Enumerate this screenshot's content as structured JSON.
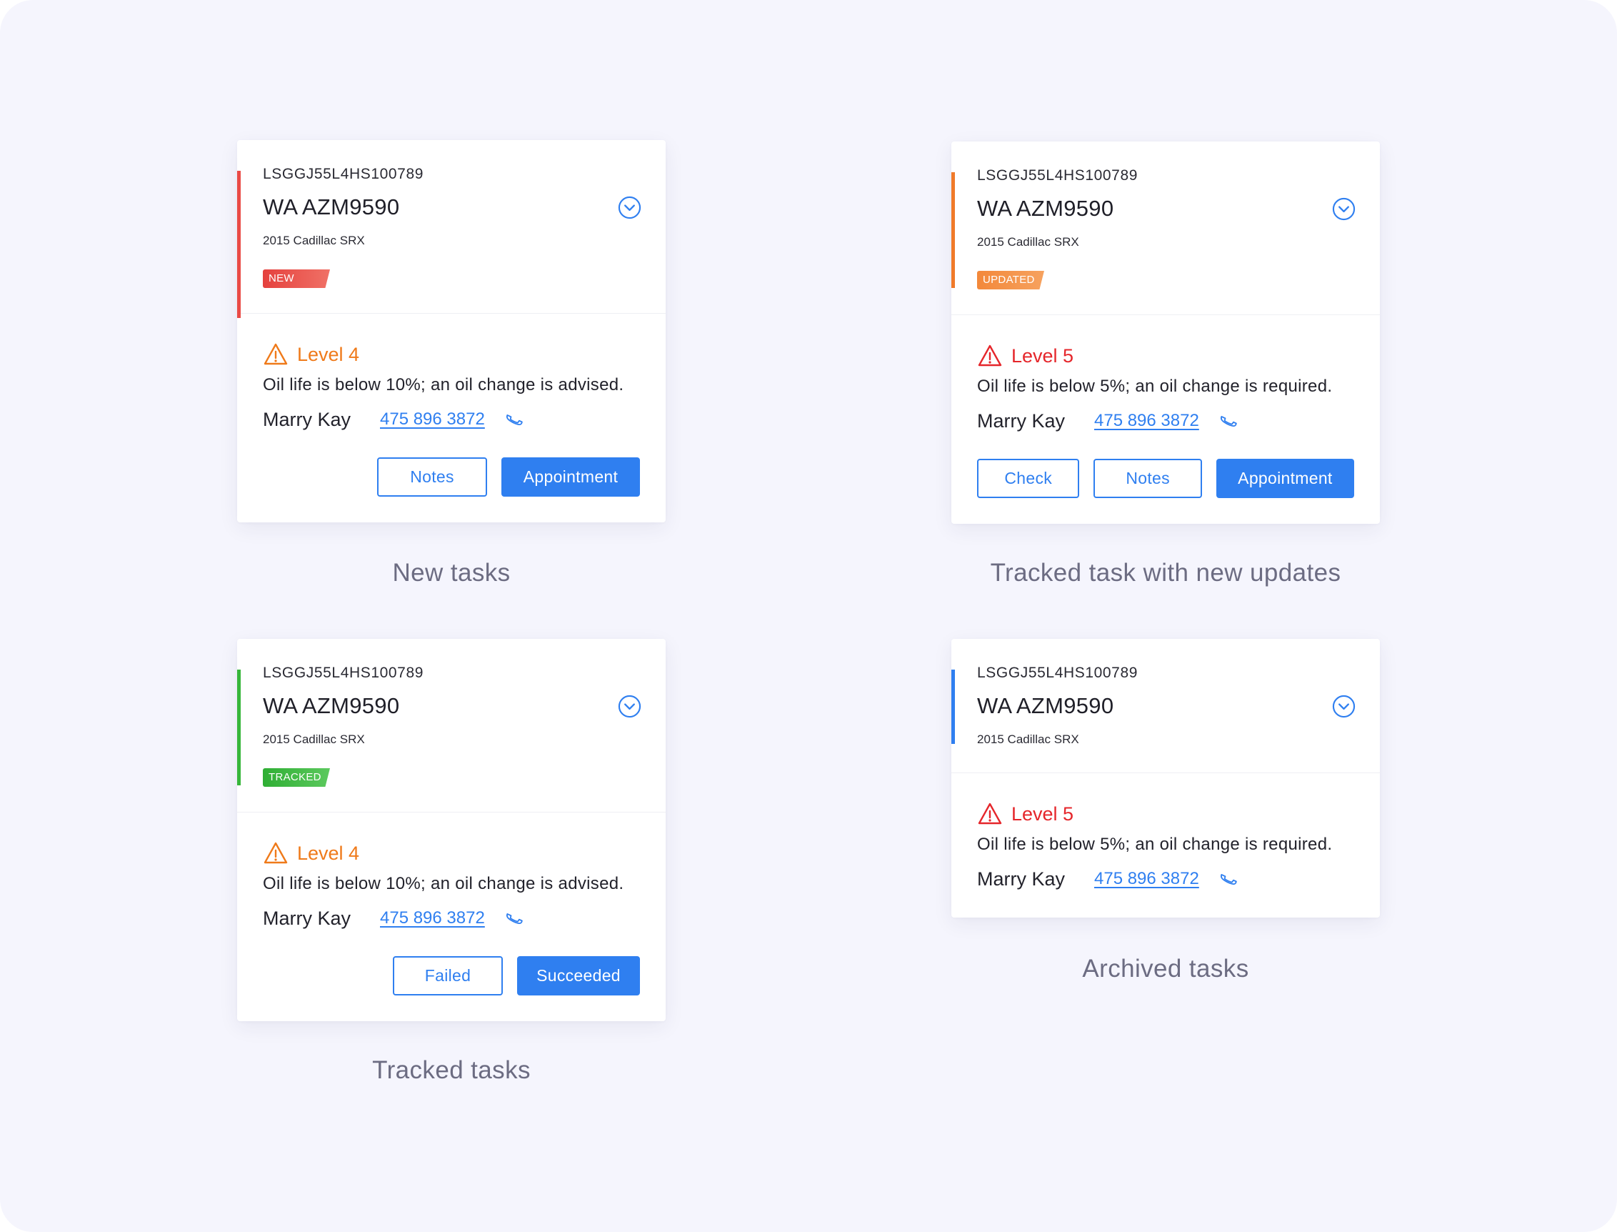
{
  "colors": {
    "background": "#f5f5fd",
    "accent": "#2f7ff0",
    "level4": "#ef7a1a",
    "level5": "#e5262b",
    "new": "#ea4a45",
    "updated": "#f49448",
    "tracked": "#36b63a",
    "archived": "#2f7ff0"
  },
  "cards": [
    {
      "vin": "LSGGJ55L4HS100789",
      "plate": "WA AZM9590",
      "model": "2015 Cadillac SRX",
      "badge": "NEW",
      "level": "Level 4",
      "message": "Oil life is below 10%; an oil change is advised.",
      "contact_name": "Marry Kay",
      "contact_phone": "475 896 3872",
      "buttons": [
        "Notes",
        "Appointment"
      ],
      "caption": "New tasks"
    },
    {
      "vin": "LSGGJ55L4HS100789",
      "plate": "WA AZM9590",
      "model": "2015 Cadillac SRX",
      "badge": "UPDATED",
      "level": "Level 5",
      "message": "Oil life is below 5%; an oil change is required.",
      "contact_name": "Marry Kay",
      "contact_phone": "475 896 3872",
      "buttons": [
        "Check",
        "Notes",
        "Appointment"
      ],
      "caption": "Tracked task with new updates"
    },
    {
      "vin": "LSGGJ55L4HS100789",
      "plate": "WA AZM9590",
      "model": "2015 Cadillac SRX",
      "badge": "TRACKED",
      "level": "Level 4",
      "message": "Oil life is below 10%; an oil change is advised.",
      "contact_name": "Marry Kay",
      "contact_phone": "475 896 3872",
      "buttons": [
        "Failed",
        "Succeeded"
      ],
      "caption": "Tracked tasks"
    },
    {
      "vin": "LSGGJ55L4HS100789",
      "plate": "WA AZM9590",
      "model": "2015 Cadillac SRX",
      "level": "Level 5",
      "message": "Oil life is below 5%; an oil change is required.",
      "contact_name": "Marry Kay",
      "contact_phone": "475 896 3872",
      "caption": "Archived tasks"
    }
  ],
  "icons": {
    "expand": "chevron-down-circle-icon",
    "warning": "warning-triangle-icon",
    "phone": "phone-icon"
  }
}
